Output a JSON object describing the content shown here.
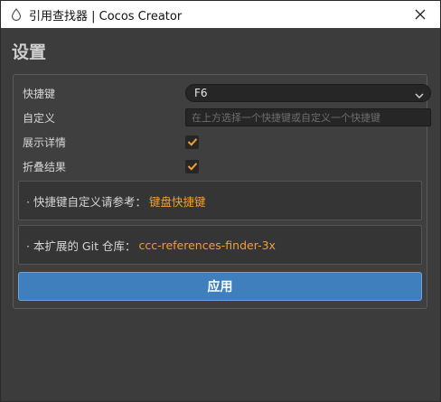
{
  "window": {
    "title": "引用查找器 | Cocos Creator",
    "app_icon": "droplet-icon",
    "close_icon": "close-icon"
  },
  "page": {
    "title": "设置"
  },
  "settings": {
    "hotkey": {
      "label": "快捷键",
      "value": "F6"
    },
    "custom": {
      "label": "自定义",
      "placeholder": "在上方选择一个快捷键或自定义一个快捷键",
      "value": ""
    },
    "show_details": {
      "label": "展示详情",
      "checked": true
    },
    "fold_results": {
      "label": "折叠结果",
      "checked": true
    }
  },
  "info": {
    "hotkey_ref": {
      "prefix": "· 快捷键自定义请参考：",
      "link": "键盘快捷键"
    },
    "git_repo": {
      "prefix": "· 本扩展的 Git 仓库：",
      "link": "ccc-references-finder-3x"
    }
  },
  "actions": {
    "apply_label": "应用"
  },
  "colors": {
    "accent": "#f0a030",
    "button": "#3f7fbd",
    "checkbox_check": "#f0a030"
  }
}
